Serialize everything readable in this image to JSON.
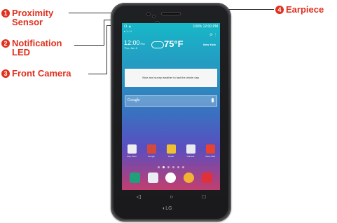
{
  "callouts": [
    {
      "number": "1",
      "label_lines": [
        "Proximity",
        "Sensor"
      ]
    },
    {
      "number": "2",
      "label_lines": [
        "Notification",
        "LED"
      ]
    },
    {
      "number": "3",
      "label_lines": [
        "Front Camera"
      ]
    },
    {
      "number": "4",
      "label_lines": [
        "Earpiece"
      ]
    }
  ],
  "screen": {
    "status_bar": {
      "signal": "☊ ▲",
      "battery": "100%",
      "time": "12:00 PM"
    },
    "sub_bar": "▸ 1 / 4",
    "weather_widget": {
      "time": "12:00",
      "ampm": "PM",
      "date": "Thu, Jan 8",
      "temperature": "75°F",
      "city": "New York",
      "top_icons": "⟳ ⋮",
      "message": "Nice and sunny weather to last the whole day."
    },
    "search": {
      "placeholder": "Google"
    },
    "apps": [
      {
        "label": "Play Store",
        "color": "#eeeeee"
      },
      {
        "label": "Google",
        "color": "#d44a3a"
      },
      {
        "label": "Email",
        "color": "#f0c030"
      },
      {
        "label": "Camera",
        "color": "#e8eaf0"
      },
      {
        "label": "Voice Mail",
        "color": "#e8432f"
      }
    ],
    "page_dots": 6,
    "active_dot": 1,
    "dock": [
      {
        "name": "phone",
        "color": "#1fa07a"
      },
      {
        "name": "contacts",
        "color": "#e9eef5"
      },
      {
        "name": "apps",
        "color": "#ffffff"
      },
      {
        "name": "chrome",
        "color": "#f2b233"
      },
      {
        "name": "messaging",
        "color": "#e0303a"
      }
    ]
  },
  "nav_buttons": {
    "back": "◁",
    "home": "○",
    "recents": "□"
  },
  "brand": "◐LG"
}
